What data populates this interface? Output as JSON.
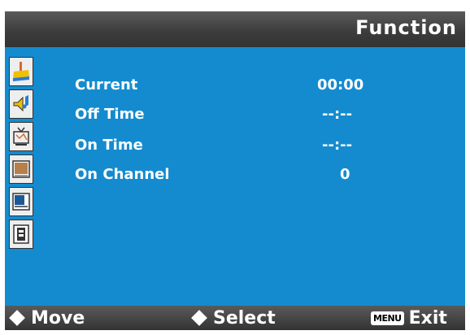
{
  "header": {
    "title": "Function"
  },
  "sidebar": {
    "items": [
      {
        "icon": "picture-icon"
      },
      {
        "icon": "audio-icon"
      },
      {
        "icon": "tv-icon"
      },
      {
        "icon": "display-icon"
      },
      {
        "icon": "screen-icon"
      },
      {
        "icon": "setup-icon"
      }
    ],
    "colors": {
      "accent": "#f0c000"
    }
  },
  "main": {
    "rows": [
      {
        "label": "Current",
        "value": "00:00"
      },
      {
        "label": "Off Time",
        "value": "--:--"
      },
      {
        "label": "On Time",
        "value": "--:--"
      },
      {
        "label": "On Channel",
        "value": "0"
      }
    ]
  },
  "footer": {
    "move": "Move",
    "select": "Select",
    "menu_badge": "MENU",
    "exit": "Exit"
  },
  "colors": {
    "panel": "#148bcf",
    "bar": "#3b3b3b",
    "text": "#ffffff"
  }
}
